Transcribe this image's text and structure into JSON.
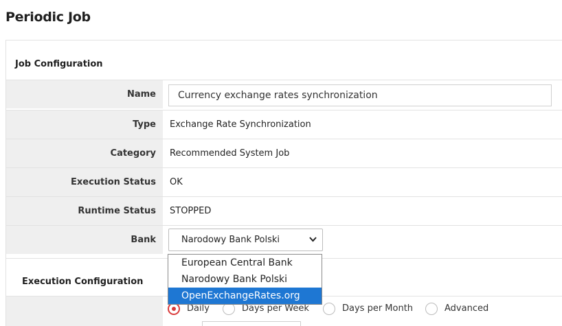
{
  "page": {
    "title": "Periodic Job"
  },
  "job_configuration": {
    "section_title": "Job Configuration",
    "name": {
      "label": "Name",
      "value": "Currency exchange rates synchronization"
    },
    "type": {
      "label": "Type",
      "value": "Exchange Rate Synchronization"
    },
    "category": {
      "label": "Category",
      "value": "Recommended System Job"
    },
    "execution_status": {
      "label": "Execution Status",
      "value": "OK"
    },
    "runtime_status": {
      "label": "Runtime Status",
      "value": "STOPPED"
    },
    "bank": {
      "label": "Bank",
      "selected": "Narodowy Bank Polski",
      "options": [
        "European Central Bank",
        "Narodowy Bank Polski",
        "OpenExchangeRates.org"
      ],
      "highlighted": "OpenExchangeRates.org"
    }
  },
  "execution_configuration": {
    "section_title": "Execution Configuration",
    "frequency": {
      "selected": "Daily",
      "options": [
        "Daily",
        "Days per Week",
        "Days per Month",
        "Advanced"
      ]
    }
  },
  "colors": {
    "accent": "#d93a3a",
    "highlight": "#1e77d3",
    "label_bg": "#efefef"
  }
}
